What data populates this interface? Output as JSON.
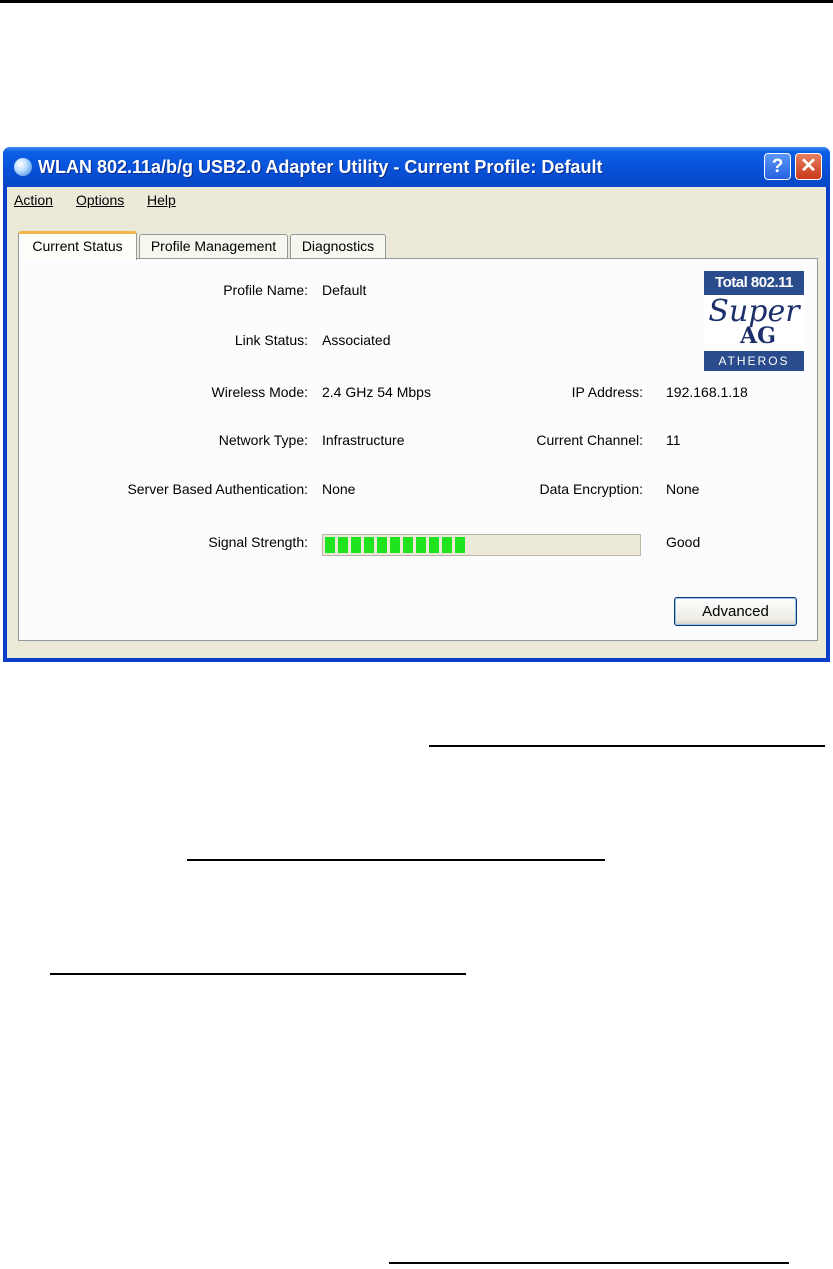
{
  "window": {
    "title": "WLAN 802.11a/b/g USB2.0 Adapter Utility - Current Profile: Default",
    "help_label": "?",
    "close_label": "✕"
  },
  "menu": [
    {
      "label": "Action"
    },
    {
      "label": "Options"
    },
    {
      "label": "Help"
    }
  ],
  "tabs": [
    {
      "label": "Current Status",
      "active": true
    },
    {
      "label": "Profile Management",
      "active": false
    },
    {
      "label": "Diagnostics",
      "active": false
    }
  ],
  "status": {
    "profile_name_label": "Profile Name:",
    "profile_name": "Default",
    "link_status_label": "Link Status:",
    "link_status": "Associated",
    "wireless_mode_label": "Wireless Mode:",
    "wireless_mode": "2.4 GHz 54 Mbps",
    "network_type_label": "Network Type:",
    "network_type": "Infrastructure",
    "server_auth_label": "Server Based Authentication:",
    "server_auth": "None",
    "signal_strength_label": "Signal Strength:",
    "signal_quality": "Good",
    "signal_level": 0.5,
    "signal_segments": 11,
    "ip_address_label": "IP Address:",
    "ip_address": "192.168.1.18",
    "current_channel_label": "Current Channel:",
    "current_channel": "11",
    "data_encryption_label": "Data Encryption:",
    "data_encryption": "None"
  },
  "logo": {
    "top": "Total 802.11",
    "middle": "Super",
    "mark": "AG",
    "bottom": "ATHEROS"
  },
  "advanced_button": "Advanced",
  "colors": {
    "titlebar": "#0851d8",
    "signal_fill": "#1fe31f",
    "tab_highlight": "#f1b54a"
  }
}
